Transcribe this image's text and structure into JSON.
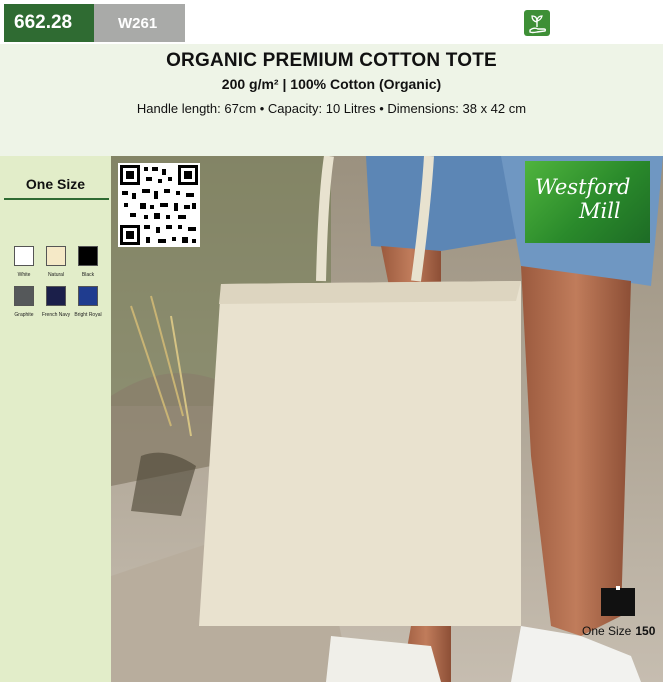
{
  "price": "662.28",
  "sku": "W261",
  "product": {
    "title": "ORGANIC PREMIUM COTTON TOTE",
    "subtitle": "200 g/m² | 100% Cotton (Organic)",
    "specs": "Handle length: 67cm • Capacity: 10 Litres • Dimensions: 38 x 42 cm"
  },
  "sidebar": {
    "size_label": "One Size",
    "colours": [
      {
        "name": "White",
        "hex": "#ffffff"
      },
      {
        "name": "Natural",
        "hex": "#f5e9c7"
      },
      {
        "name": "Black",
        "hex": "#000000"
      },
      {
        "name": "Graphite",
        "hex": "#55585a"
      },
      {
        "name": "French Navy",
        "hex": "#1b1f4a"
      },
      {
        "name": "Bright Royal",
        "hex": "#1f3c8f"
      }
    ]
  },
  "brand": {
    "line1": "Westford",
    "line2": "Mill"
  },
  "size_box": {
    "label": "One Size",
    "count": "150"
  },
  "icons": {
    "eco": "hand-with-sprout-icon",
    "qr": "qr-code-icon"
  },
  "colors": {
    "badge_green": "#2f6b32",
    "badge_grey": "#a9aaa8",
    "header_bg": "#eef4e7",
    "sidebar_bg": "#e2edc9"
  }
}
